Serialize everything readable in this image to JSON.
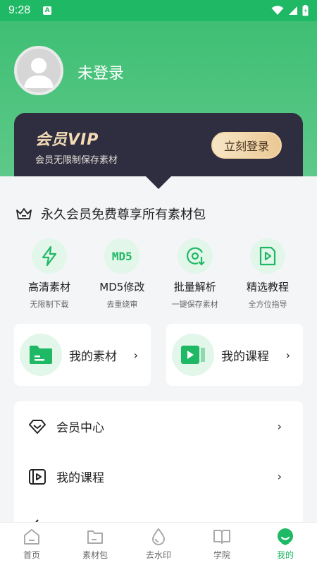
{
  "status_bar": {
    "time": "9:28",
    "notification_icon": "A"
  },
  "header": {
    "login_text": "未登录",
    "vip": {
      "title": "会员VIP",
      "subtitle": "会员无限制保存素材",
      "login_button": "立刻登录"
    }
  },
  "perm": {
    "text": "永久会员免费尊享所有素材包"
  },
  "features": [
    {
      "icon": "lightning-icon",
      "title": "高清素材",
      "sub": "无限制下载"
    },
    {
      "icon": "md5-icon",
      "icon_text": "MD5",
      "title": "MD5修改",
      "sub": "去重绕审"
    },
    {
      "icon": "batch-download-icon",
      "title": "批量解析",
      "sub": "一键保存素材"
    },
    {
      "icon": "video-tutorial-icon",
      "title": "精选教程",
      "sub": "全方位指导"
    }
  ],
  "quick": [
    {
      "icon": "folder-icon",
      "label": "我的素材",
      "arrow": "›"
    },
    {
      "icon": "play-icon",
      "label": "我的课程",
      "arrow": "›"
    }
  ],
  "menu": [
    {
      "icon": "diamond-icon",
      "label": "会员中心",
      "arrow": "›"
    },
    {
      "icon": "video-icon",
      "label": "我的课程",
      "arrow": "›"
    }
  ],
  "tabs": [
    {
      "label": "首页",
      "icon": "home-icon",
      "active": false
    },
    {
      "label": "素材包",
      "icon": "folder-icon",
      "active": false
    },
    {
      "label": "去水印",
      "icon": "drop-icon",
      "active": false
    },
    {
      "label": "学院",
      "icon": "book-icon",
      "active": false
    },
    {
      "label": "我的",
      "icon": "profile-icon",
      "active": true
    }
  ],
  "colors": {
    "primary": "#1fb864",
    "vip_dark": "#2f2d40",
    "gold": "#f3dcb5",
    "header_green": "#5ec98a"
  }
}
